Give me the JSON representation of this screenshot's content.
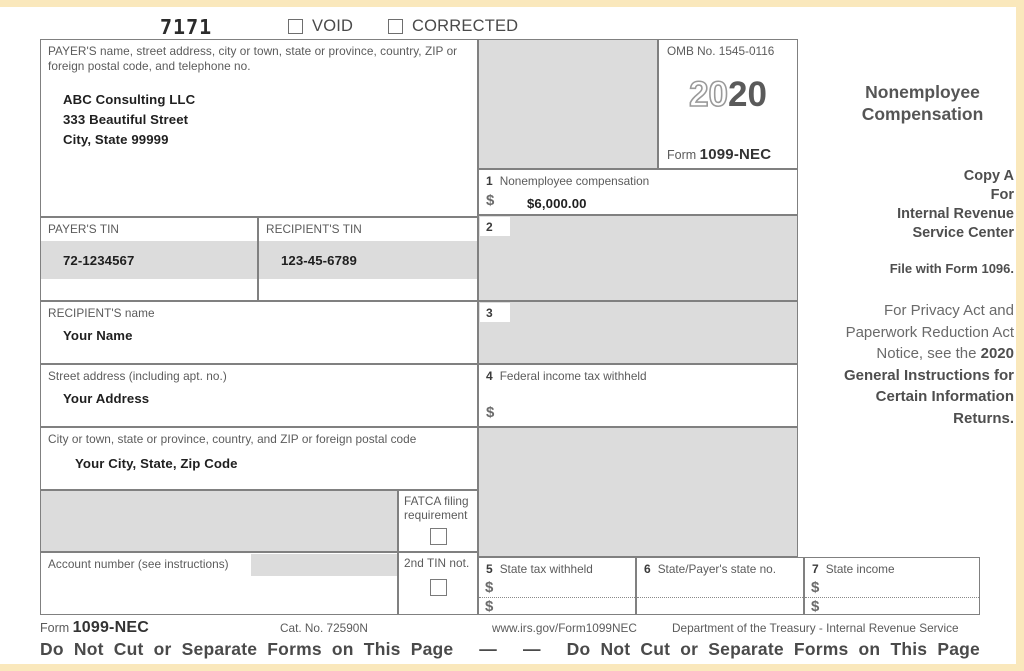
{
  "form": {
    "ocr_number": "7171",
    "void_label": "VOID",
    "corrected_label": "CORRECTED",
    "title_line1": "Nonemployee",
    "title_line2": "Compensation",
    "omb_label": "OMB No. 1545-0116",
    "year_dim": "20",
    "year_bold": "20",
    "form_word": "Form",
    "form_number": "1099-NEC"
  },
  "payer": {
    "caption": "PAYER'S name, street address, city or town, state or province, country, ZIP or foreign postal code, and telephone no.",
    "name": "ABC Consulting LLC",
    "street": "333 Beautiful Street",
    "citystatezip": "City, State 99999",
    "tin_caption": "PAYER'S TIN",
    "tin_value": "72-1234567"
  },
  "recipient": {
    "tin_caption": "RECIPIENT'S TIN",
    "tin_value": "123-45-6789",
    "name_caption": "RECIPIENT'S name",
    "name_value": "Your Name",
    "street_caption": "Street address (including apt. no.)",
    "street_value": "Your Address",
    "city_caption": "City or town, state or province, country, and ZIP or foreign postal code",
    "city_value": "Your City, State, Zip Code",
    "account_caption": "Account number (see instructions)",
    "account_value": "",
    "fatca_caption_line1": "FATCA filing",
    "fatca_caption_line2": "requirement",
    "second_tin_caption": "2nd TIN not."
  },
  "boxes": {
    "b1": {
      "num": "1",
      "label": "Nonemployee compensation",
      "dollar": "$",
      "value": "$6,000.00"
    },
    "b2": {
      "num": "2",
      "label": "",
      "value": ""
    },
    "b3": {
      "num": "3",
      "label": "",
      "value": ""
    },
    "b4": {
      "num": "4",
      "label": "Federal income tax withheld",
      "dollar": "$",
      "value": ""
    },
    "b5": {
      "num": "5",
      "label": "State tax withheld",
      "dollar1": "$",
      "dollar2": "$",
      "value1": "",
      "value2": ""
    },
    "b6": {
      "num": "6",
      "label": "State/Payer's state no.",
      "value1": "",
      "value2": ""
    },
    "b7": {
      "num": "7",
      "label": "State income",
      "dollar1": "$",
      "dollar2": "$",
      "value1": "",
      "value2": ""
    }
  },
  "copy": {
    "line1": "Copy A",
    "line2": "For",
    "line3": "Internal Revenue",
    "line4": "Service Center",
    "file_with": "File with Form 1096.",
    "privacy_normal": "For Privacy Act and Paperwork Reduction Act Notice, see the ",
    "privacy_bold": "2020 General Instructions for Certain Information Returns."
  },
  "footer": {
    "form_word": "Form",
    "form_number": "1099-NEC",
    "cat_no": "Cat. No. 72590N",
    "url": "www.irs.gov/Form1099NEC",
    "department": "Department of the Treasury - Internal Revenue Service",
    "donotcut_left": "Do  Not  Cut  or  Separate  Forms  on  This  Page",
    "dash_left": "—",
    "dash_right": "—",
    "donotcut_right": "Do  Not  Cut  or  Separate  Forms  on  This  Page"
  }
}
